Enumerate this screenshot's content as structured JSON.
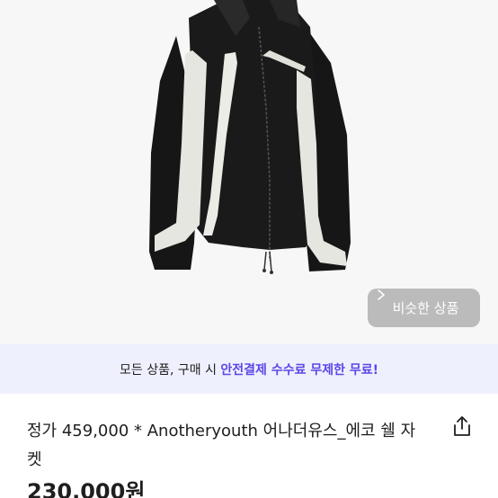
{
  "product": {
    "image_alt": "black and white zip-up shell jacket",
    "similar_button_label": "비슷한 상품",
    "title": "정가 459,000 * Anotheryouth 어나더유스_에코 쉘 자켓",
    "price": "230,000원"
  },
  "promo": {
    "prefix": "모든 상품, 구매 시 ",
    "highlight": "안전결제 수수료 무제한 무료!"
  },
  "icons": {
    "share": "share-icon",
    "similar_chevron": "chevron-right-icon"
  },
  "colors": {
    "accent": "#5a48e6",
    "banner_bg": "#eff0fe",
    "text": "#1e1e1e"
  }
}
